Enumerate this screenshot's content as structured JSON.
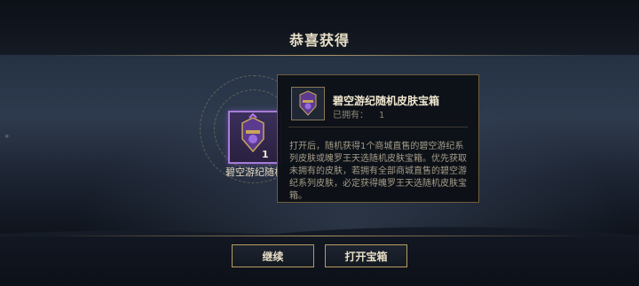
{
  "header": {
    "title": "恭喜获得"
  },
  "reward": {
    "name": "碧空游纪随机",
    "count": "1"
  },
  "tooltip": {
    "title": "碧空游纪随机皮肤宝箱",
    "owned_label": "已拥有：",
    "owned_value": "1",
    "description": "打开后，随机获得1个商城直售的碧空游纪系列皮肤或魄罗王天选随机皮肤宝箱。优先获取未拥有的皮肤，若拥有全部商城直售的碧空游纪系列皮肤，必定获得魄罗王天选随机皮肤宝箱。"
  },
  "buttons": {
    "continue_label": "继续",
    "open_label": "打开宝箱"
  },
  "colors": {
    "gold": "#b89c62",
    "rarity_purple": "#a77cd6"
  },
  "icons": {
    "reward_icon": "skin-chest-icon",
    "tooltip_icon": "skin-chest-icon"
  }
}
